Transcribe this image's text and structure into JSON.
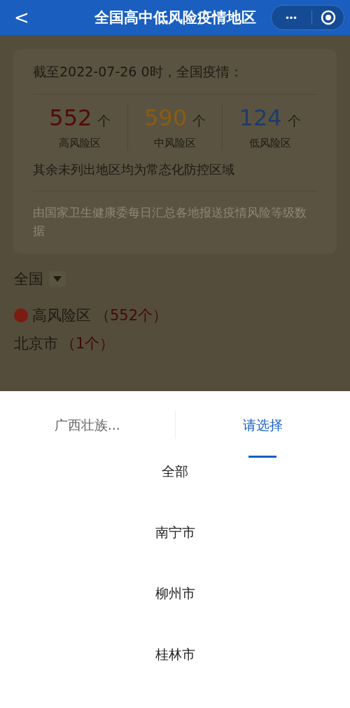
{
  "nav": {
    "title": "全国高中低风险疫情地区",
    "back": "<",
    "more": "•••"
  },
  "summary": {
    "heading": "截至2022-07-26 0时，全国疫情：",
    "stats": [
      {
        "kind": "high",
        "count": "552",
        "unit": "个",
        "label": "高风险区"
      },
      {
        "kind": "medium",
        "count": "590",
        "unit": "个",
        "label": "中风险区"
      },
      {
        "kind": "low",
        "count": "124",
        "unit": "个",
        "label": "低风险区"
      }
    ],
    "note": "其余未列出地区均为常态化防控区域",
    "source": "由国家卫生健康委每日汇总各地报送疫情风险等级数据"
  },
  "region_select": {
    "label": "全国"
  },
  "risk_group": {
    "label": "高风险区",
    "count": "（552个）",
    "color": "#7a1c12"
  },
  "city": {
    "name": "北京市",
    "count": "（1个）"
  },
  "sheet": {
    "tabs": [
      {
        "label": "广西壮族...",
        "selected": false
      },
      {
        "label": "请选择",
        "selected": true
      }
    ],
    "options": [
      "全部",
      "南宁市",
      "柳州市",
      "桂林市"
    ]
  }
}
